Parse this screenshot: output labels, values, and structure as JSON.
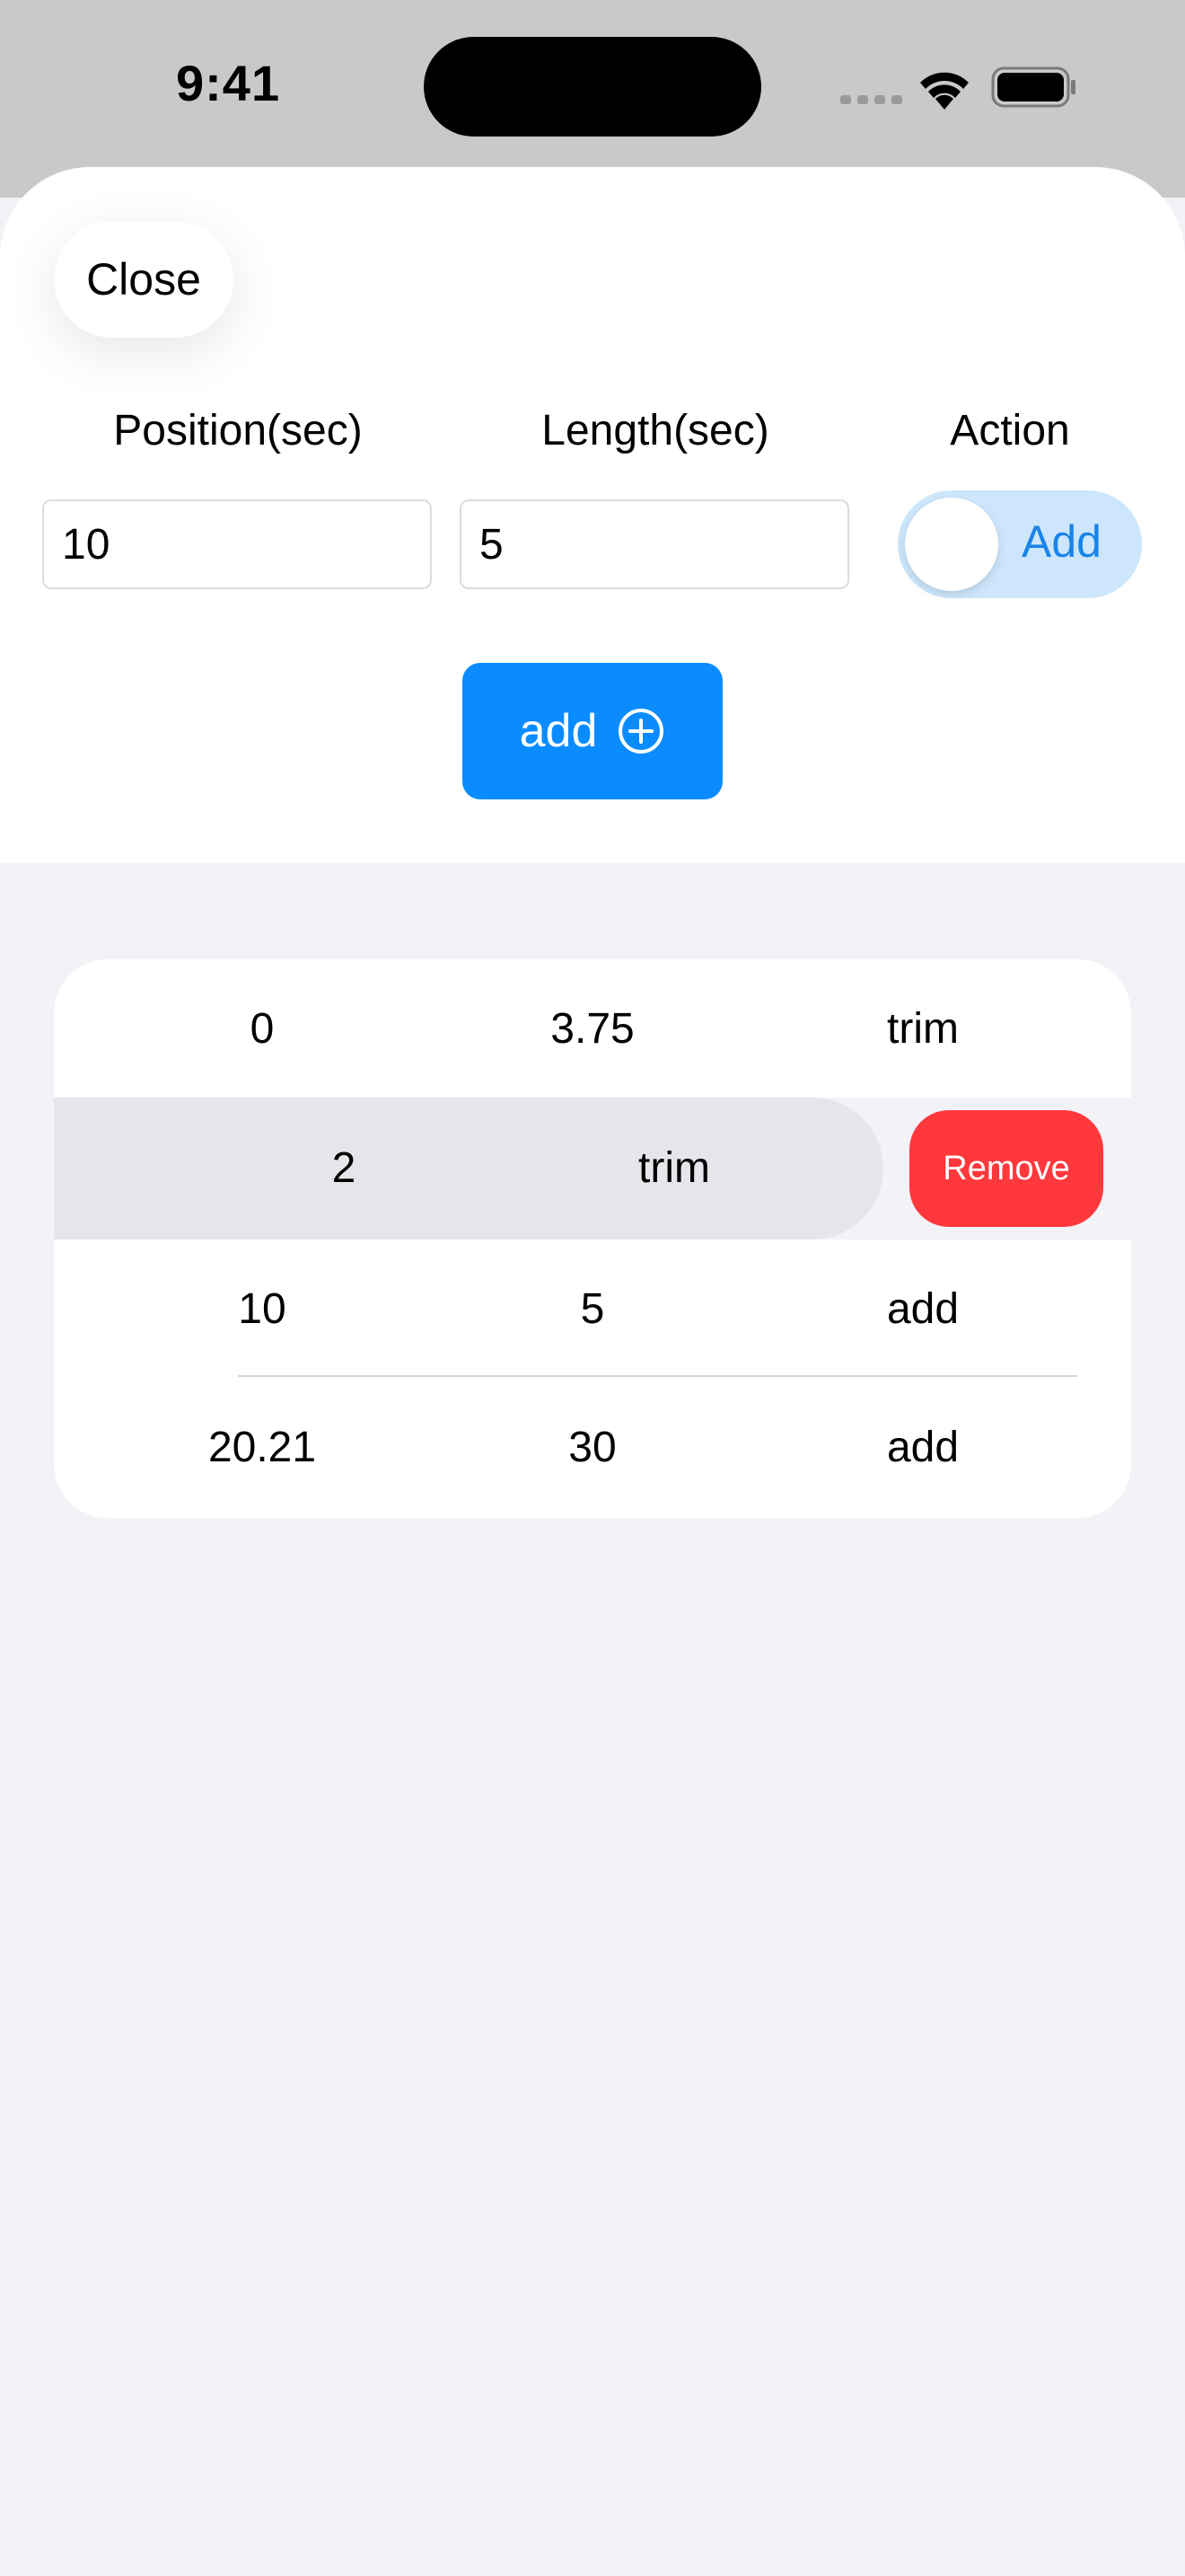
{
  "status_bar": {
    "time": "9:41",
    "icons": [
      "cellular-icon",
      "wifi-icon",
      "battery-icon"
    ]
  },
  "sheet": {
    "close_label": "Close",
    "columns": {
      "position_label": "Position(sec)",
      "length_label": "Length(sec)",
      "action_label": "Action"
    },
    "position_value": "10",
    "length_value": "5",
    "action_toggle": {
      "label": "Add",
      "on": false
    },
    "add_button_label": "add",
    "add_button_icon": "plus-circle-icon"
  },
  "list": {
    "rows": [
      {
        "position": "0",
        "length": "3.75",
        "action": "trim"
      },
      {
        "position": "2",
        "length": "trim",
        "swiped": true
      },
      {
        "position": "10",
        "length": "5",
        "action": "add"
      },
      {
        "position": "20.21",
        "length": "30",
        "action": "add"
      }
    ],
    "remove_label": "Remove"
  },
  "colors": {
    "accent": "#0A8CFF",
    "toggle_track": "#CDE6FB",
    "destructive": "#FF383C",
    "background": "#F2F2F7",
    "swiped_row": "#E5E5EA"
  }
}
